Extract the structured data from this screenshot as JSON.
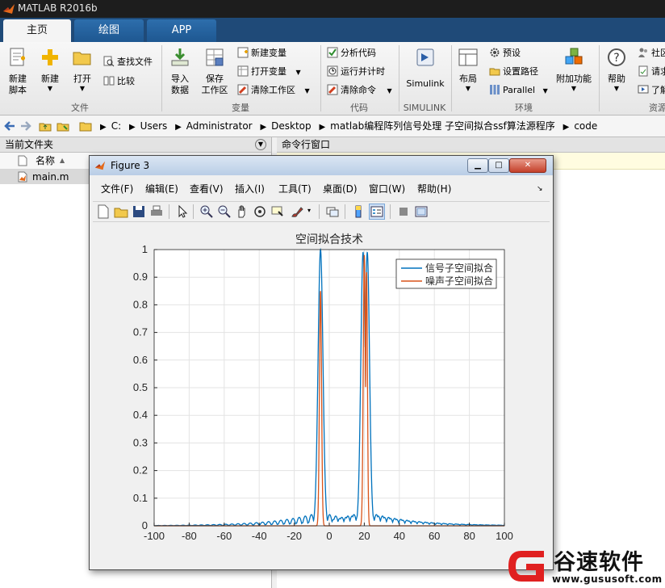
{
  "app": {
    "title": "MATLAB R2016b"
  },
  "tabs": [
    "主页",
    "绘图",
    "APP"
  ],
  "ribbon": {
    "file": {
      "new_script": [
        "新建",
        "脚本"
      ],
      "new": "新建",
      "open": "打开",
      "find_files": "查找文件",
      "compare": "比较",
      "group": "文件"
    },
    "variable": {
      "import": [
        "导入",
        "数据"
      ],
      "save": [
        "保存",
        "工作区"
      ],
      "new_var": "新建变量",
      "open_var": "打开变量",
      "clear_ws": "清除工作区",
      "group": "变量"
    },
    "code": {
      "analyze": "分析代码",
      "run_time": "运行并计时",
      "clear_cmd": "清除命令",
      "group": "代码"
    },
    "simulink": {
      "label": "Simulink",
      "group": "SIMULINK"
    },
    "env": {
      "layout": "布局",
      "prefs": "预设",
      "set_path": "设置路径",
      "parallel": "Parallel",
      "addons": "附加功能",
      "group": "环境"
    },
    "res": {
      "help": "帮助",
      "community": "社区",
      "request": "请求",
      "learn": "了解",
      "group": "资源"
    }
  },
  "address": {
    "path": [
      "C:",
      "Users",
      "Administrator",
      "Desktop",
      "matlab编程阵列信号处理 子空间拟合ssf算法源程序",
      "code"
    ]
  },
  "current_folder": {
    "title": "当前文件夹",
    "column": "名称",
    "files": [
      "main.m"
    ]
  },
  "command_window": {
    "title": "命令行窗口"
  },
  "figure": {
    "title": "Figure 3",
    "menu": [
      "文件(F)",
      "编辑(E)",
      "查看(V)",
      "插入(I)",
      "工具(T)",
      "桌面(D)",
      "窗口(W)",
      "帮助(H)"
    ]
  },
  "chart_data": {
    "type": "line",
    "title": "空间拟合技术",
    "xlabel": "",
    "ylabel": "",
    "xlim": [
      -100,
      100
    ],
    "ylim": [
      0,
      1
    ],
    "xticks": [
      -100,
      -80,
      -60,
      -40,
      -20,
      0,
      20,
      40,
      60,
      80,
      100
    ],
    "yticks": [
      0,
      0.1,
      0.2,
      0.3,
      0.4,
      0.5,
      0.6,
      0.7,
      0.8,
      0.9,
      1
    ],
    "grid": true,
    "legend_position": "top-right",
    "series": [
      {
        "name": "信号子空间拟合",
        "color": "#0072bd",
        "peaks": [
          {
            "x": -5,
            "height": 1.0,
            "width": 1.4
          },
          {
            "x": 19.3,
            "height": 0.99,
            "width": 1.3
          },
          {
            "x": 21.7,
            "height": 0.99,
            "width": 1.3
          }
        ],
        "sidelobe_level": 0.05,
        "sidelobe_decay": 25
      },
      {
        "name": "噪声子空间拟合",
        "color": "#d95319",
        "peaks": [
          {
            "x": -5,
            "height": 0.85,
            "width": 0.6
          },
          {
            "x": 20,
            "height": 0.98,
            "width": 0.6
          },
          {
            "x": 21.3,
            "height": 0.92,
            "width": 0.5
          }
        ],
        "sidelobe_level": 0.0,
        "sidelobe_decay": 10
      }
    ]
  },
  "watermark": {
    "text": "谷速软件",
    "url": "www.gususoft.com"
  }
}
